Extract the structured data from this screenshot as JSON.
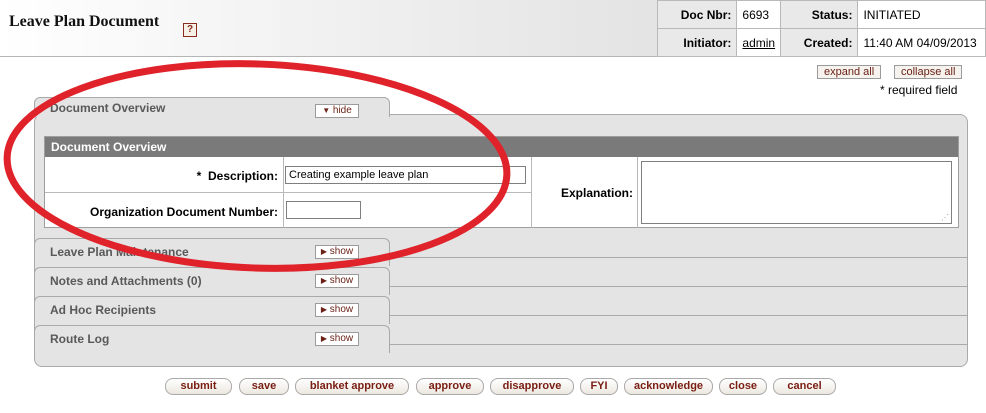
{
  "header": {
    "title": "Leave Plan Document",
    "help_icon": "help-icon",
    "doc_nbr_label": "Doc Nbr:",
    "doc_nbr": "6693",
    "status_label": "Status:",
    "status": "INITIATED",
    "initiator_label": "Initiator:",
    "initiator": "admin",
    "created_label": "Created:",
    "created": "11:40 AM 04/09/2013"
  },
  "controls": {
    "expand_all": "expand all",
    "collapse_all": "collapse all",
    "required_note": "* required field"
  },
  "tabs": [
    {
      "title": "Document Overview",
      "toggle": "hide"
    },
    {
      "title": "Leave Plan Maintenance",
      "toggle": "show"
    },
    {
      "title": "Notes and Attachments (0)",
      "toggle": "show"
    },
    {
      "title": "Ad Hoc Recipients",
      "toggle": "show"
    },
    {
      "title": "Route Log",
      "toggle": "show"
    }
  ],
  "overview": {
    "section_header": "Document Overview",
    "description_label": "Description:",
    "description_value": "Creating example leave plan",
    "org_doc_number_label": "Organization Document Number:",
    "org_doc_number_value": "",
    "explanation_label": "Explanation:",
    "required_marker": "*"
  },
  "actions": [
    "submit",
    "save",
    "blanket approve",
    "approve",
    "disapprove",
    "FYI",
    "acknowledge",
    "close",
    "cancel"
  ],
  "colors": {
    "annotation": "#e0222a",
    "button_text": "#7a1d12",
    "section_header_bg": "#7a7a7a"
  }
}
